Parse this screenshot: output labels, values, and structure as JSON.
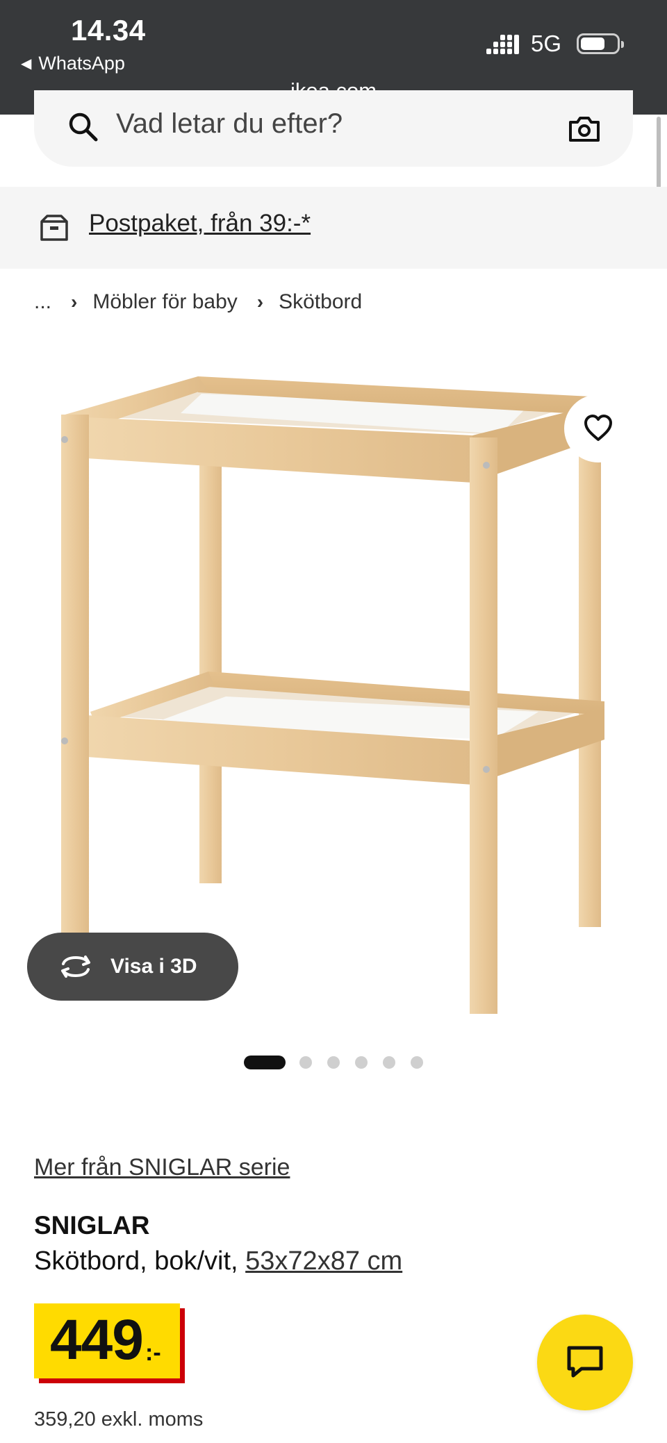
{
  "status_bar": {
    "time": "14.34",
    "back_app": "WhatsApp",
    "network": "5G",
    "url": "ikea.com"
  },
  "search": {
    "placeholder": "Vad letar du efter?"
  },
  "delivery": {
    "link_text": "Postpaket, från 39:-*"
  },
  "breadcrumb": {
    "items": [
      "...",
      "Möbler för baby",
      "Skötbord"
    ]
  },
  "gallery": {
    "view_3d_label": "Visa i 3D",
    "image_count": 6,
    "active_index": 0
  },
  "product": {
    "series_link": "Mer från SNIGLAR serie",
    "name": "SNIGLAR",
    "description": "Skötbord, bok/vit, ",
    "dimensions": "53x72x87 cm",
    "price": "449",
    "price_suffix": ":-",
    "price_excl_vat": "359,20 exkl. moms"
  },
  "icons": {
    "search": "search-icon",
    "camera": "camera-icon",
    "delivery": "parcel-icon",
    "favourite": "heart-icon",
    "rotate": "rotate-3d-icon",
    "chat": "chat-icon"
  },
  "colors": {
    "status_bar_bg": "#37393b",
    "price_yellow": "#ffdb00",
    "price_shadow_red": "#cc0008",
    "chat_button": "#fbd914",
    "view3d_bg": "#484848"
  }
}
